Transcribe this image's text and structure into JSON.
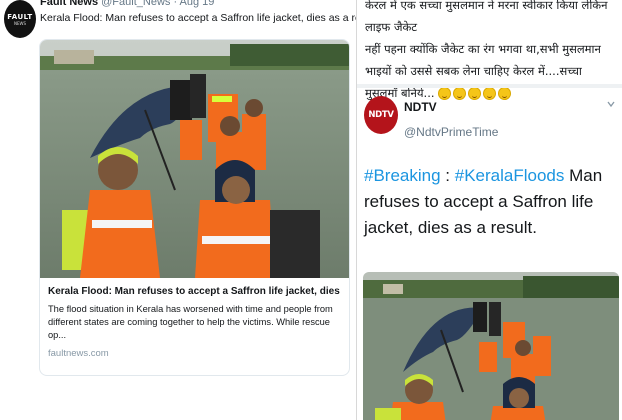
{
  "left_tweet": {
    "avatar_line1": "FAULT",
    "avatar_line2": "NEWS",
    "author_name": "Fault News",
    "author_handle": "@Fault_News · Aug 19",
    "text": "Kerala Flood: Man refuses to accept a Saffron life jacket, dies as a result",
    "card": {
      "title": "Kerala Flood: Man refuses to accept a Saffron life jacket, dies as a re...",
      "description": "The flood situation in Kerala has worsened with time and people from different states are coming together to help the victims. While rescue op...",
      "domain": "faultnews.com"
    }
  },
  "right_tweet": {
    "hindi_lines": [
      "केरल में एक सच्चा मुसलमान ने मरना स्वीकार किया लेकिन लाइफ जैकेट",
      "नहीं पहना क्योंकि जैकेट का रंग भगवा था,सभी मुसलमान",
      "भाइयों को उससे सबक लेना चाहिए केरल में....सच्चा",
      "मुसलमाँ बनिये..."
    ],
    "emoji": [
      "grinning-face",
      "grinning-face",
      "grinning-face",
      "grinning-face",
      "grinning-face"
    ],
    "quoted": {
      "logo_text": "NDTV",
      "name": "NDTV",
      "handle": "@NdtvPrimeTime",
      "hashtag_1": "#Breaking",
      "separator": " : ",
      "hashtag_2": "#KeralaFloods",
      "text": " Man refuses to accept a Saffron life jacket, dies as a result."
    }
  },
  "colors": {
    "hashtag_blue": "#1b95e0",
    "ndtv_red": "#b4141b",
    "life_jacket_orange": "#f26b1d",
    "flood_water": "#7d8f7d"
  }
}
